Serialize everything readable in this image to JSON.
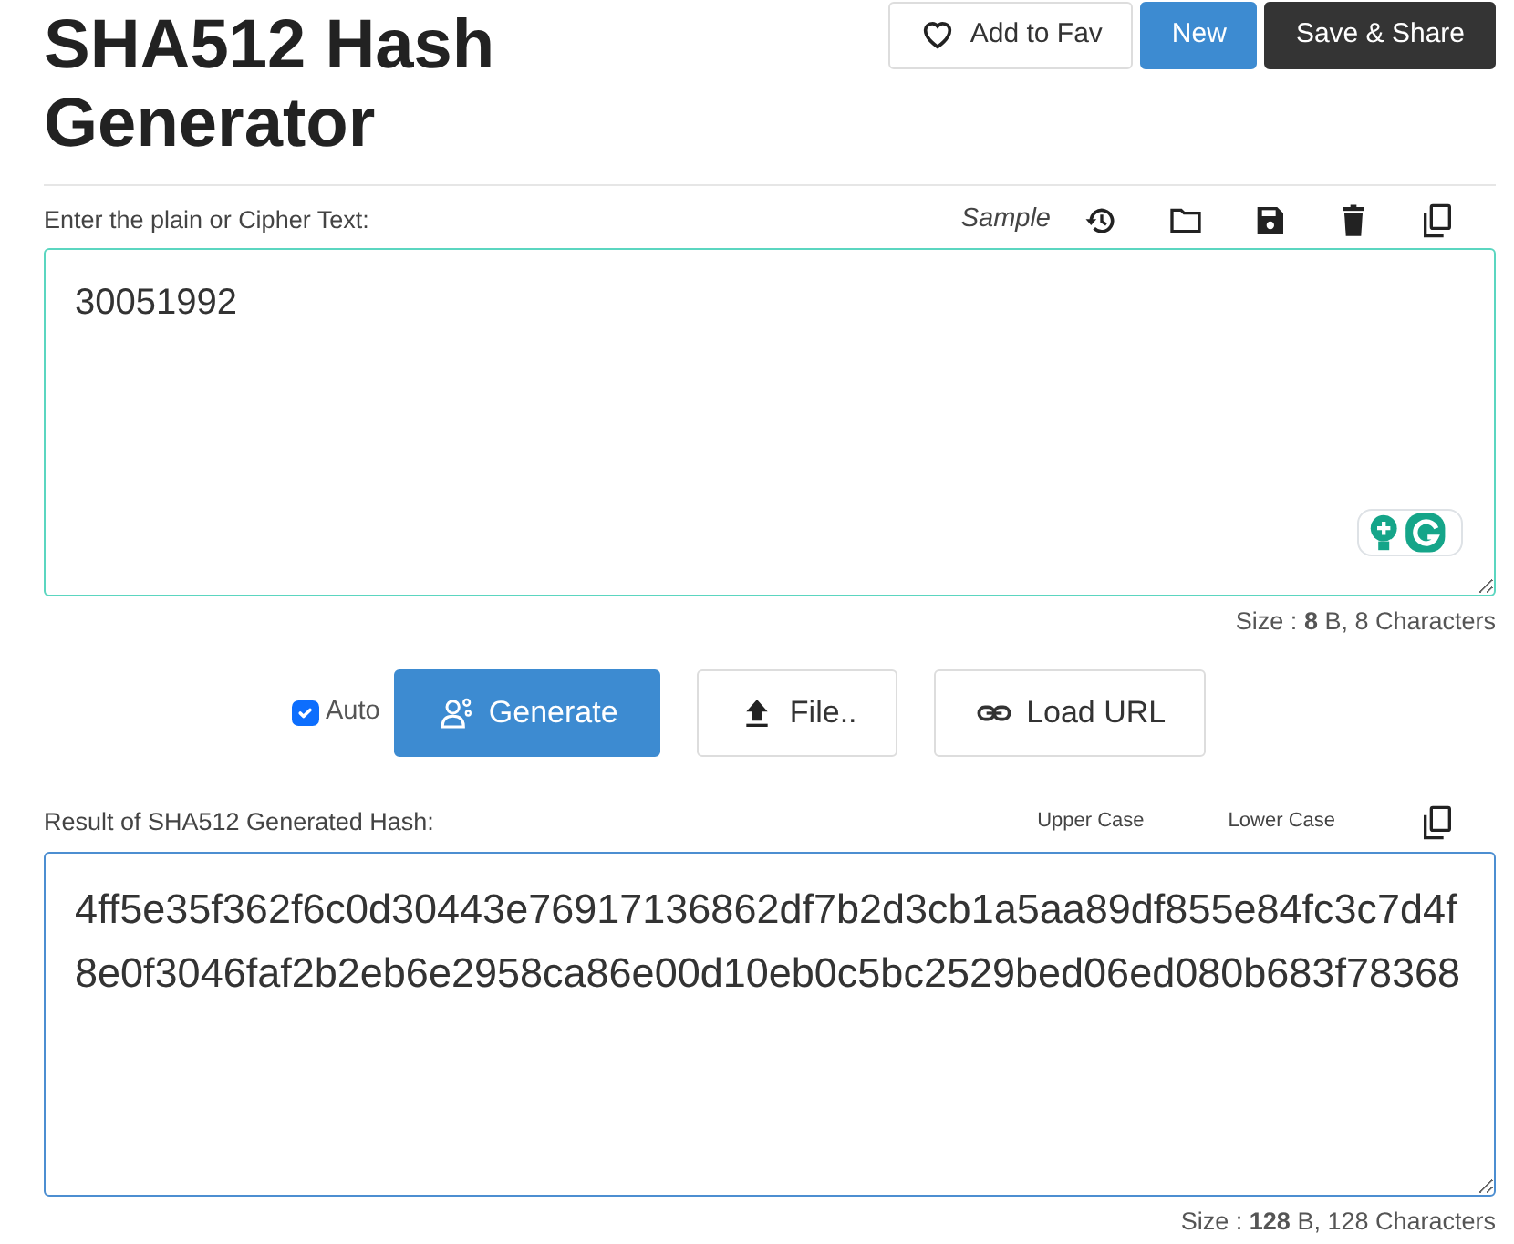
{
  "title": "SHA512 Hash Generator",
  "header_buttons": [
    {
      "kind": "fav",
      "label": "Add to Fav"
    },
    {
      "kind": "new",
      "label": "New"
    },
    {
      "kind": "share",
      "label": "Save & Share"
    }
  ],
  "input": {
    "label": "Enter the plain or Cipher Text:",
    "sample": "Sample",
    "tools": [
      {
        "kind": "history"
      },
      {
        "kind": "open"
      },
      {
        "kind": "save"
      },
      {
        "kind": "delete"
      },
      {
        "kind": "copy"
      }
    ],
    "value": "30051992",
    "size": "Size : **8** B, 8 Characters"
  },
  "controls": {
    "auto": {
      "label": "Auto",
      "checked": true
    },
    "buttons": [
      {
        "kind": "generate",
        "label": "Generate"
      },
      {
        "kind": "file",
        "label": "File.."
      },
      {
        "kind": "url",
        "label": "Load URL"
      }
    ]
  },
  "output": {
    "label": "Result of SHA512 Generated Hash:",
    "case_options": [
      "Upper Case",
      "Lower Case"
    ],
    "value": "4ff5e35f362f6c0d30443e76917136862df7b2d3cb1a5aa89df855e84fc3c7d4f8e0f3046faf2b2eb6e2958ca86e00d10eb0c5bc2529bed06ed080b683f78368",
    "size": "Size : **128** B, 128 Characters"
  }
}
